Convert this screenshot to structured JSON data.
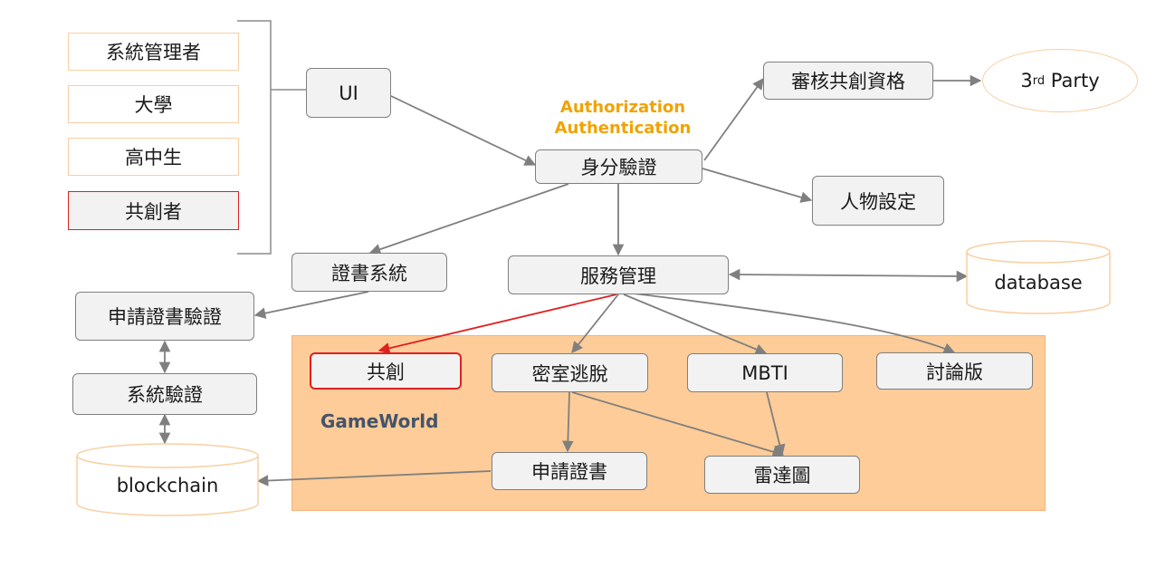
{
  "roles": {
    "admin": "系統管理者",
    "university": "大學",
    "highschool": "高中生",
    "cocreator": "共創者"
  },
  "nodes": {
    "ui": "UI",
    "identity_verification": "身分驗證",
    "review_cocreation": "審核共創資格",
    "third_party_prefix": "3",
    "third_party_sup": "rd",
    "third_party_suffix": " Party",
    "character_settings": "人物設定",
    "certificate_system": "證書系統",
    "service_management": "服務管理",
    "database": "database",
    "apply_cert_verify": "申請證書驗證",
    "system_verify": "系統驗證",
    "blockchain": "blockchain",
    "cocreation": "共創",
    "escape_room": "密室逃脫",
    "mbti": "MBTI",
    "forum": "討論版",
    "apply_cert": "申請證書",
    "radar_chart": "雷達圖"
  },
  "labels": {
    "authorization": "Authorization",
    "authentication": "Authentication",
    "gameworld": "GameWorld"
  },
  "colors": {
    "gameworld_fill": "#fdcc98",
    "highlight": "#e02020",
    "auth_text": "#f0a300",
    "gameworld_text": "#44546a",
    "arrow": "#7f7f7f"
  }
}
